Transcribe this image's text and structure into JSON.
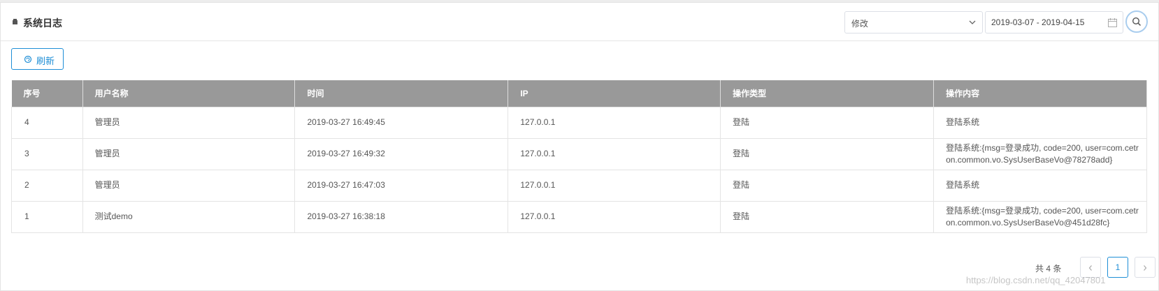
{
  "header": {
    "title": "系统日志",
    "filter_select_value": "修改",
    "date_range": "2019-03-07 - 2019-04-15"
  },
  "toolbar": {
    "refresh_label": "刷新"
  },
  "table": {
    "columns": [
      "序号",
      "用户名称",
      "时间",
      "IP",
      "操作类型",
      "操作内容"
    ],
    "rows": [
      [
        "4",
        "管理员",
        "2019-03-27 16:49:45",
        "127.0.0.1",
        "登陆",
        "登陆系统"
      ],
      [
        "3",
        "管理员",
        "2019-03-27 16:49:32",
        "127.0.0.1",
        "登陆",
        "登陆系统:{msg=登录成功, code=200, user=com.cetron.common.vo.SysUserBaseVo@78278add}"
      ],
      [
        "2",
        "管理员",
        "2019-03-27 16:47:03",
        "127.0.0.1",
        "登陆",
        "登陆系统"
      ],
      [
        "1",
        "测试demo",
        "2019-03-27 16:38:18",
        "127.0.0.1",
        "登陆",
        "登陆系统:{msg=登录成功, code=200, user=com.cetron.common.vo.SysUserBaseVo@451d28fc}"
      ]
    ]
  },
  "pagination": {
    "total_text": "共 4 条",
    "current_page": "1",
    "prev_icon": "chevron-left-icon",
    "next_icon": "chevron-right-icon"
  },
  "watermark": "https://blog.csdn.net/qq_42047801",
  "colors": {
    "accent": "#1e8ed6",
    "table_header_bg": "#999999"
  }
}
